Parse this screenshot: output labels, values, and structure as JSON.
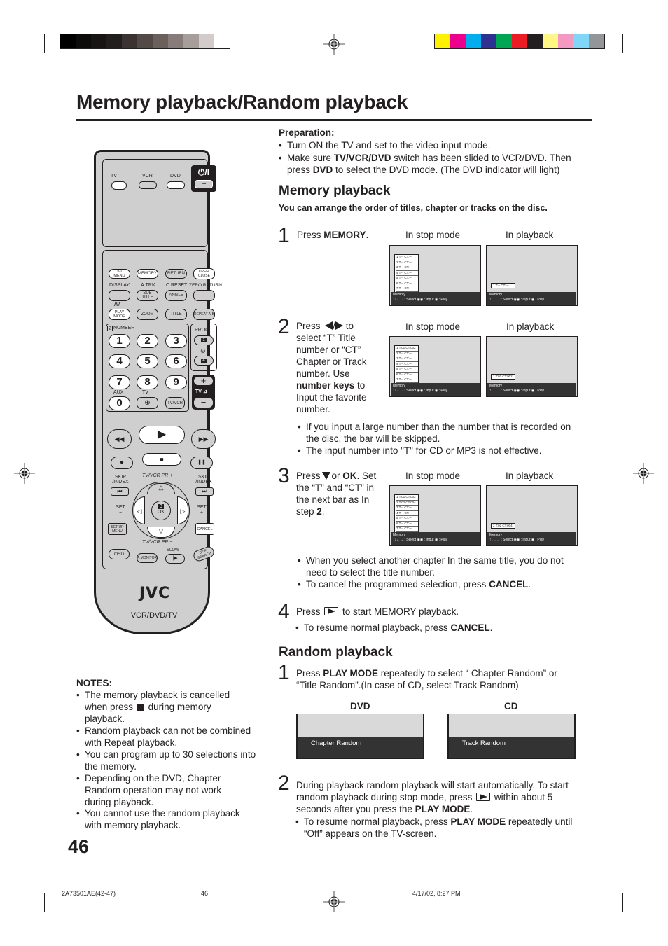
{
  "page": {
    "title": "Memory playback/Random playback",
    "page_number": "46"
  },
  "print_marks": {
    "grayscale_swatches": [
      "#000000",
      "#0d0b0a",
      "#171412",
      "#221e1c",
      "#3b3331",
      "#534946",
      "#6c605d",
      "#877c79",
      "#a79e9c",
      "#d4cccb",
      "#ffffff"
    ],
    "color_swatches": [
      "#fff200",
      "#ec008c",
      "#00aeef",
      "#2e3192",
      "#00a651",
      "#ed1c24",
      "#231f20",
      "#fff685",
      "#f49ac1",
      "#7fd6f7",
      "#939598"
    ]
  },
  "remote": {
    "source_labels": {
      "tv": "TV",
      "vcr": "VCR",
      "dvd": "DVD"
    },
    "power_label": "⏻/I",
    "power_dots": "•••",
    "row1": [
      "DVD MENU",
      "MEMORY",
      "RETURN",
      "OPEN/ CLOSE"
    ],
    "row2_labels": [
      "DISPLAY",
      "A.TRK",
      "C.RESET",
      "ZERO RETURN"
    ],
    "row2_buttons": [
      "",
      "SUB TITLE",
      "ANGLE",
      ""
    ],
    "row3": [
      "PLAY MODE",
      "ZOOM",
      "TITLE",
      "REPEAT A-B"
    ],
    "number_label": "NUMBER",
    "number_step_badge": "2",
    "numbers": [
      "1",
      "2",
      "3",
      "4",
      "5",
      "6",
      "7",
      "8",
      "9",
      "0"
    ],
    "aux_label": "AUX",
    "tv_label": "TV",
    "tvvcr_label": "TV/VCR",
    "input_icon": "⊕",
    "prog_label": "PROG.",
    "prog_buttons": [
      "1",
      "4"
    ],
    "timer_icon": "⊙",
    "vol_plus": "+",
    "vol_minus": "−",
    "vol_label": "TV ⊿",
    "transport": {
      "rew": "◀◀",
      "play": "▶",
      "ff": "▶▶",
      "rec": "●",
      "stop": "■",
      "pause": "❚❚"
    },
    "skip_index_label": "SKIP /INDEX",
    "skip_prev": "⏮",
    "skip_next": "⏭",
    "tvvcr_pr_plus": "TV/VCR PR +",
    "tvvcr_pr_minus": "TV/VCR PR −",
    "set_minus": "SET −",
    "set_plus": "SET +",
    "ok_badge": "3",
    "ok_label": "OK",
    "arrows": {
      "up": "△",
      "down": "▽",
      "left": "◁",
      "right": "▷"
    },
    "setup_menu": "SET UP MENU",
    "cancel": "CANCEL",
    "osd": "OSD",
    "a_monitor": "A.MONITOR",
    "slow_label": "SLOW",
    "slow_btn": "|▶",
    "skip_search": "SKIP SEARCH",
    "brand": "JVC",
    "model": "VCR/DVD/TV"
  },
  "notes": {
    "heading": "NOTES:",
    "items": [
      "The memory playback is cancelled when press",
      "during memory playback.",
      "Random playback can not be combined with Repeat playback.",
      "You can program up to 30 selections into the memory.",
      "Depending on the DVD, Chapter Random operation may not work during playback.",
      "You cannot use the random playback with memory playback."
    ]
  },
  "preparation": {
    "heading": "Preparation:",
    "item1": "Turn ON the TV and set to the video input mode.",
    "item2_a": "Make sure ",
    "item2_b": "TV/VCR/DVD",
    "item2_c": " switch has been slided to VCR/DVD. Then press ",
    "item2_d": "DVD",
    "item2_e": " to select the DVD mode. (The DVD indicator will light)"
  },
  "memory": {
    "heading": "Memory playback",
    "intro": "You can arrange the order of titles, chapter or tracks on the disc.",
    "stop_mode": "In stop mode",
    "in_playback": "In playback",
    "step1": {
      "num": "1",
      "a": "Press ",
      "b": "MEMORY",
      "c": "."
    },
    "step2": {
      "num": "2",
      "a": "Press",
      "sep": "/",
      "b": " to select “T” Title number or “CT” Chapter or Track number. Use ",
      "c": "number keys",
      "d": " to Input the favorite number."
    },
    "step2_bullets": [
      "If you input a large number than the number that is recorded on the disc, the bar will be skipped.",
      "The input number into \"T\" for CD or MP3 is not effective."
    ],
    "step3": {
      "num": "3",
      "a": "Press",
      "b": "or ",
      "c": "OK",
      "d": ". Set the “T” and “CT” in the next bar as In step ",
      "e": "2",
      "f": "."
    },
    "step3_bullets": {
      "b1": "When you select another chapter In the same title, you do not need to select the title number.",
      "b2a": "To cancel the programmed selection, press ",
      "b2b": "CANCEL",
      "b2c": "."
    },
    "step4": {
      "num": "4",
      "a": "Press",
      "b": " to start MEMORY playback."
    },
    "step4_bullet": {
      "a": "To resume normal playback, press ",
      "b": "CANCEL",
      "c": "."
    },
    "osd": {
      "title": "Memory",
      "hint": "↑↓←→ : Select  ◉◉ : Input   ◉ : Play"
    },
    "screens": {
      "s1_stop": [
        "1 T:--  CT:---",
        "2 T:--  CT:---",
        "3 T:--  CT:---",
        "4 T:--  CT:---",
        "5 T:--  CT:---",
        "6 T:--  CT:---",
        "7 T:--  CT:---"
      ],
      "s1_play": "1 T:--  CT:---",
      "s2_stop": [
        "1 T:01  CT:002",
        "2 T:--  CT:---",
        "3 T:--  CT:---",
        "4 T:--  CT:---",
        "5 T:--  CT:---",
        "6 T:--  CT:---",
        "7 T:--  CT:---"
      ],
      "s2_play": "1 T:01  CT:002",
      "s3_stop": [
        "1 T:01  CT:002",
        "2 T:02  CT:004",
        "3 T:--  CT:---",
        "4 T:--  CT:---",
        "5 T:--  CT:---",
        "6 T:--  CT:---",
        "7 T:--  CT:---"
      ],
      "s3_play": "2 T:02  CT:004"
    }
  },
  "random": {
    "heading": "Random playback",
    "step1": {
      "num": "1",
      "a": "Press ",
      "b": "PLAY MODE",
      "c": " repeatedly to select “ Chapter Random” or “Title Random”.(In case of CD, select Track Random)"
    },
    "dvd_label": "DVD",
    "cd_label": "CD",
    "dvd_osd": "Chapter Random",
    "cd_osd": "Track Random",
    "step2": {
      "num": "2",
      "a": "During playback random playback will start automatically. To start random playback during stop mode, press",
      "b": " within about 5 seconds after you press the ",
      "c": "PLAY MODE",
      "d": "."
    },
    "step2_bullet": {
      "a": "To resume normal playback, press ",
      "b": "PLAY MODE",
      "c": " repeatedly until “Off” appears on the TV-screen."
    }
  },
  "footer": {
    "doc_code": "2A73501AE(42-47)",
    "page": "46",
    "timestamp": "4/17/02, 8:27 PM"
  }
}
